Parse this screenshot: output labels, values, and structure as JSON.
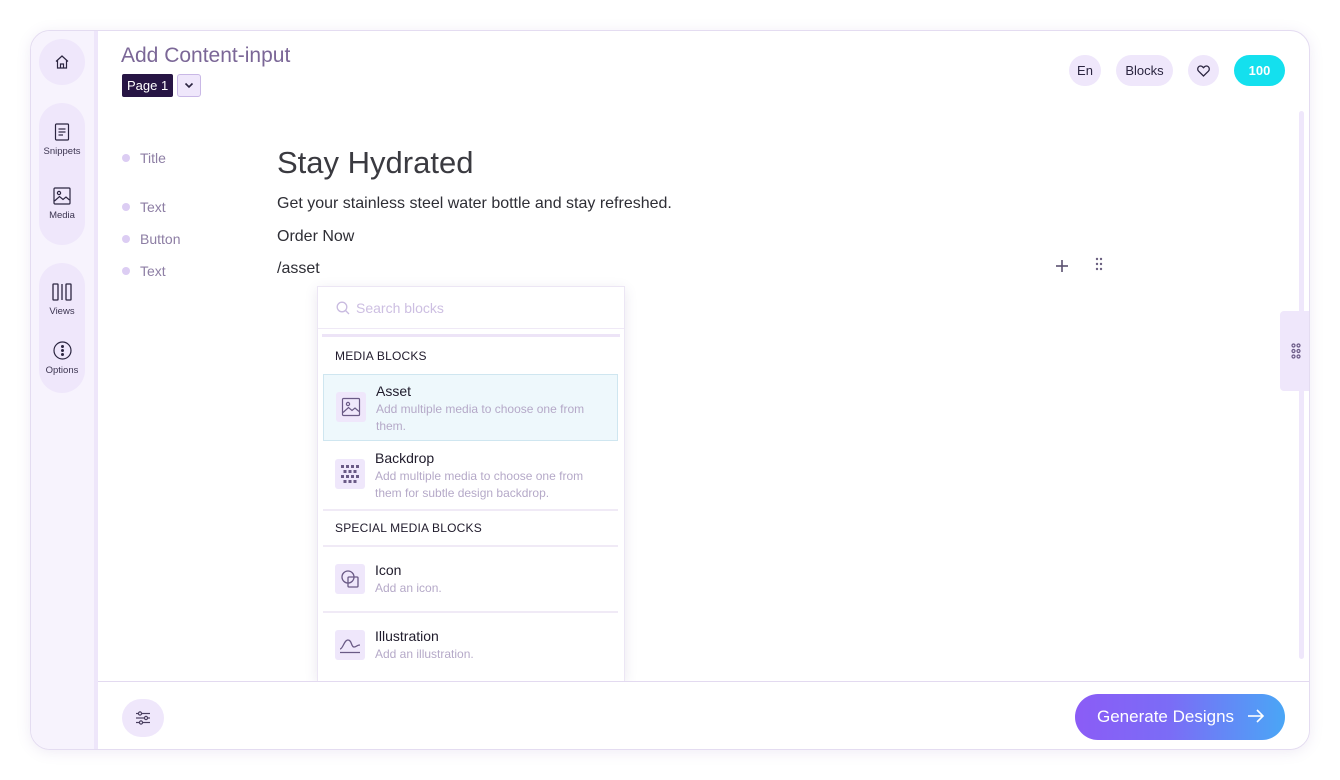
{
  "sidebar": {
    "home_icon": "home-icon",
    "items": [
      {
        "label": "Snippets",
        "icon": "document-icon"
      },
      {
        "label": "Media",
        "icon": "image-icon"
      },
      {
        "label": "Views",
        "icon": "columns-icon"
      },
      {
        "label": "Options",
        "icon": "more-vertical-icon"
      }
    ]
  },
  "header": {
    "title": "Add Content-input",
    "page_badge": "Page 1",
    "lang": "En",
    "blocks": "Blocks",
    "credits": "100"
  },
  "rows": [
    {
      "label": "Title",
      "value": "Stay Hydrated"
    },
    {
      "label": "Text",
      "value": "Get your stainless steel water bottle and stay refreshed."
    },
    {
      "label": "Button",
      "value": "Order Now"
    },
    {
      "label": "Text",
      "value": "/asset"
    }
  ],
  "menu": {
    "search_placeholder": "Search blocks",
    "sections": [
      {
        "title": "MEDIA BLOCKS",
        "items": [
          {
            "title": "Asset",
            "desc": "Add multiple media to choose one from them.",
            "icon": "image-icon",
            "selected": true
          },
          {
            "title": "Backdrop",
            "desc": "Add multiple media to choose one from them for subtle design backdrop.",
            "icon": "grid-pattern-icon",
            "selected": false
          }
        ]
      },
      {
        "title": "SPECIAL MEDIA BLOCKS",
        "items": [
          {
            "title": "Icon",
            "desc": "Add an icon.",
            "icon": "shapes-icon",
            "selected": false
          },
          {
            "title": "Illustration",
            "desc": "Add an illustration.",
            "icon": "wave-icon",
            "selected": false
          }
        ]
      }
    ]
  },
  "footer": {
    "generate_label": "Generate Designs"
  },
  "colors": {
    "accent": "#8b5cf6",
    "sidebar_bg": "#f7f3fd",
    "pill_bg": "#efe7fb",
    "credits_bg": "#14e0ee",
    "page_badge_bg": "#271544",
    "selected_item_bg": "#eef8fc"
  }
}
